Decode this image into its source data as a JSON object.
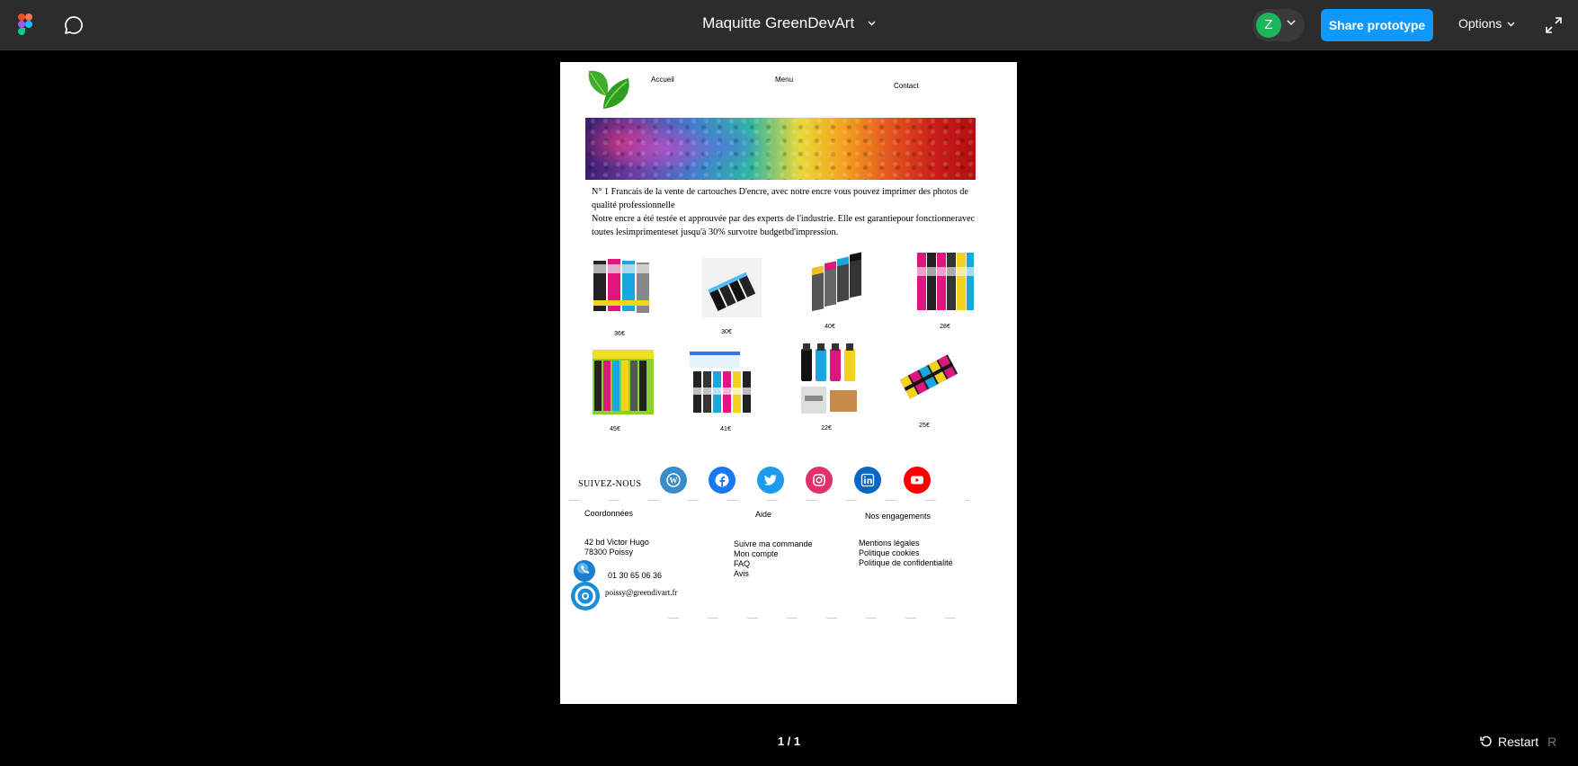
{
  "toolbar": {
    "file_title": "Maquitte GreenDevArt",
    "avatar_initial": "Z",
    "share_label": "Share prototype",
    "options_label": "Options",
    "icons": [
      "figma-logo-icon",
      "comment-icon",
      "chevron-down-icon",
      "fullscreen-icon"
    ],
    "accent_color": "#0d99ff"
  },
  "site": {
    "nav": [
      "Accueil",
      "Menu",
      "Contact"
    ],
    "intro_line1": "N° 1 Francais de la vente de cartouches D'encre, avec notre encre vous pouvez imprimer des photos de qualité professionnelle",
    "intro_line2": "Notre encre a été testée et approuvée par des experts de l'industrie. Elle est garantiepour fonctionneravec toutes lesimprimenteset jusqu'à 30% survotre budgetbd'impression.",
    "products": [
      {
        "price": "36€"
      },
      {
        "price": "30€"
      },
      {
        "price": "40€"
      },
      {
        "price": "28€"
      },
      {
        "price": "45€"
      },
      {
        "price": "41€"
      },
      {
        "price": "22€"
      },
      {
        "price": "25€"
      }
    ],
    "follow_label": "SUIVEZ-NOUS",
    "social_icons": [
      "wordpress-icon",
      "facebook-icon",
      "twitter-icon",
      "instagram-icon",
      "linkedin-icon",
      "youtube-icon"
    ],
    "footer": {
      "contact_heading": "Coordonnées",
      "address_line1": "42 bd Victor Hugo",
      "address_line2": "78300 Poissy",
      "phone": "01 30 65 06 36",
      "email": "poissy@greendivart.fr",
      "help_heading": "Aide",
      "help_links": [
        "Suivre ma commande",
        "Mon compte",
        "FAQ",
        "Avis"
      ],
      "engage_heading": "Nos engagements",
      "engage_links": [
        "Mentions légales",
        "Politique cookies",
        "Politique de confidentialité"
      ]
    }
  },
  "player": {
    "page_counter": "1 / 1",
    "restart_label": "Restart",
    "restart_key": "R"
  }
}
